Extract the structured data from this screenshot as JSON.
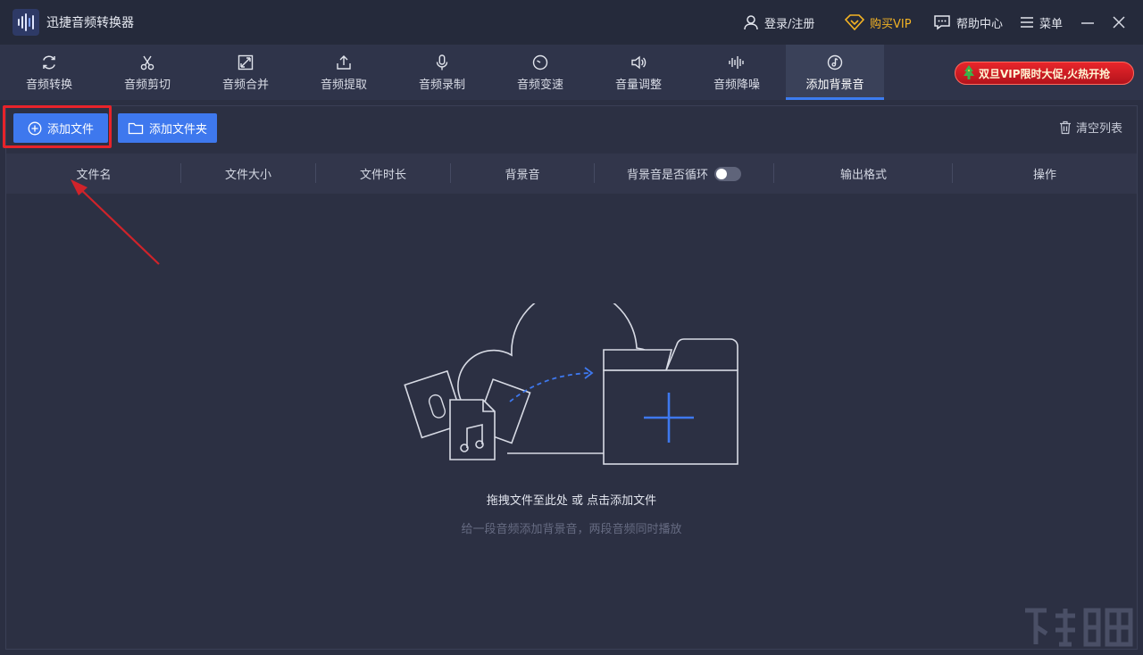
{
  "app": {
    "title": "迅捷音频转换器"
  },
  "titlebar": {
    "login": "登录/注册",
    "vip": "购买VIP",
    "help": "帮助中心",
    "menu": "菜单"
  },
  "tools": [
    {
      "label": "音频转换",
      "icon": "refresh-icon"
    },
    {
      "label": "音频剪切",
      "icon": "scissors-icon"
    },
    {
      "label": "音频合并",
      "icon": "merge-icon"
    },
    {
      "label": "音频提取",
      "icon": "upload-icon"
    },
    {
      "label": "音频录制",
      "icon": "microphone-icon"
    },
    {
      "label": "音频变速",
      "icon": "speed-icon"
    },
    {
      "label": "音量调整",
      "icon": "volume-icon"
    },
    {
      "label": "音频降噪",
      "icon": "waveform-icon"
    },
    {
      "label": "添加背景音",
      "icon": "music-note-icon",
      "active": true
    }
  ],
  "promo": {
    "text": "双旦VIP限时大促,火热开抢"
  },
  "toolbar": {
    "add_file": "添加文件",
    "add_folder": "添加文件夹",
    "clear_list": "清空列表"
  },
  "table": {
    "columns": [
      "文件名",
      "文件大小",
      "文件时长",
      "背景音",
      "背景音是否循环",
      "输出格式",
      "操作"
    ],
    "loop_enabled": false
  },
  "empty": {
    "main": "拖拽文件至此处 或 点击添加文件",
    "sub": "给一段音频添加背景音，两段音频同时播放"
  },
  "colors": {
    "accent": "#3e78ee",
    "highlight": "#e8232a",
    "vip": "#f3b324"
  }
}
